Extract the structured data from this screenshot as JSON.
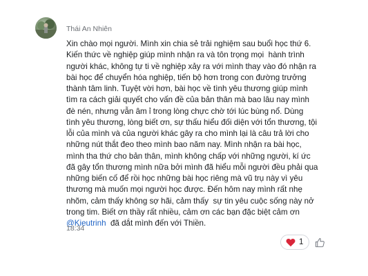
{
  "post": {
    "author": "Thái An Nhiên",
    "lines": [
      "Xin chào mọi người. Mình xin chia sẻ trải nghiệm sau buổi học thứ 6.",
      "Kiến thức về nghiệp giúp mình nhận ra và tôn trọng mọi  hành trình",
      "người khác, không tự ti về nghiệp xảy ra với mình thay vào đó nhận ra",
      "bài học để chuyển hóa nghiệp, tiến bộ hơn trong con đường trưởng",
      "thành tâm linh. Tuyệt vời hơn, bài học về tình yêu thương giúp mình",
      "tìm ra cách giải quyết cho vấn đề của bản thân mà bao lâu nay mình",
      "đè nén, nhưng vẫn âm ỉ trong lòng chực chờ tới lúc bùng nổ. Dùng",
      "tình yêu thương, lòng biết ơn, sự thấu hiểu đối diện với tổn thương, tội",
      "lỗi của mình và của người khác gây ra cho mình lại là câu trả lời cho",
      "những nút thắt đeo theo mình bao năm nay. Mình nhận ra bài học,",
      "mình tha thứ cho bản thân, mình không chấp với những người, kí ức",
      "đã gây tổn thương mình nữa bởi mình đã hiểu mỗi người đều phải qua",
      "những biến cố để rồi học những bài học riêng mà vũ trụ này vì yêu",
      "thương mà muốn mọi người học được. Đến hôm nay mình rất nhẹ",
      "nhõm, cảm thấy không sợ hãi, cảm thấy  sự tin yêu cuộc sống này nở",
      "trong tim. Biết ơn thầy rất nhiều, cảm ơn các bạn đặc biệt cảm ơn"
    ],
    "mention": "@Kieutrinh",
    "last_line_rest": "  đã dắt mình đến với Thiền.",
    "time": "18:34",
    "reaction_count": "1"
  },
  "icons": {
    "reaction": "heart-icon",
    "add_reaction": "thumbs-up-icon"
  },
  "colors": {
    "heart": "#d9263a",
    "mention": "#1f63c5",
    "meta_text": "#6b6f74",
    "body_text": "#1a1c1f"
  }
}
